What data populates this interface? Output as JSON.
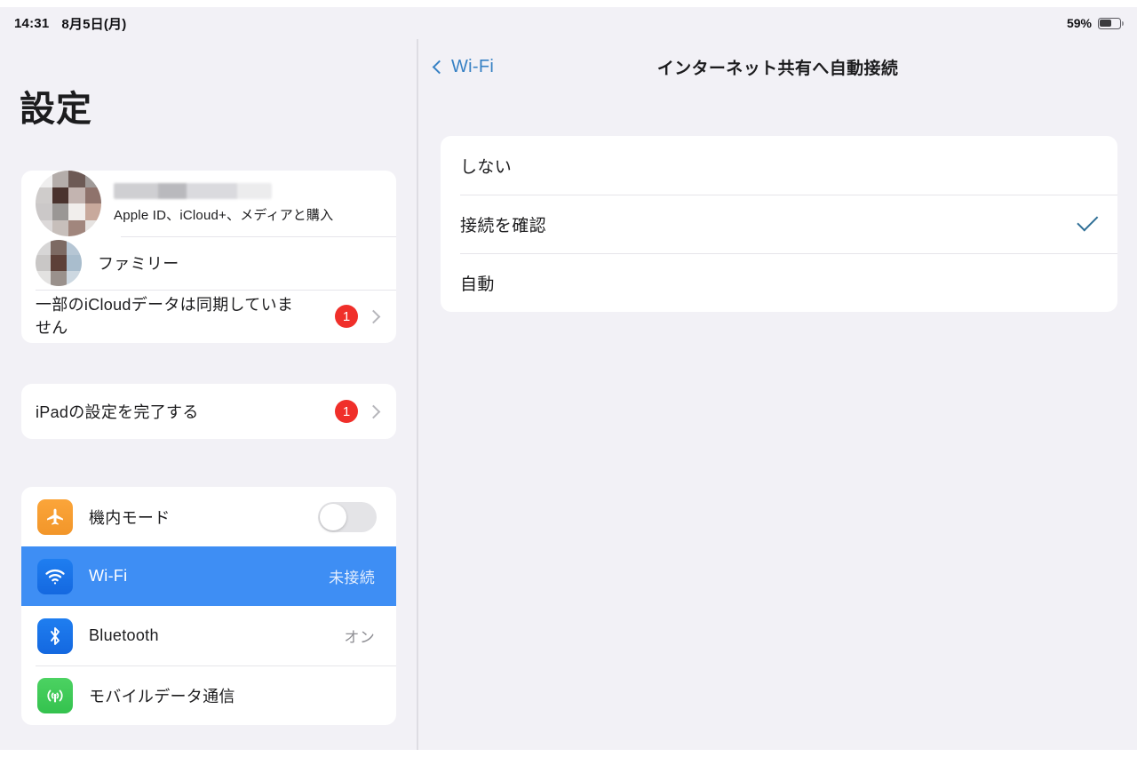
{
  "status_bar": {
    "time": "14:31",
    "date": "8月5日(月)",
    "battery_percent": "59%",
    "battery_level": 59
  },
  "sidebar": {
    "title": "設定",
    "account_card": {
      "name_redacted": true,
      "subtitle": "Apple ID、iCloud+、メディアと購入",
      "family_label": "ファミリー",
      "icloud_warning": "一部のiCloudデータは同期していません",
      "icloud_badge": "1"
    },
    "setup_card": {
      "label": "iPadの設定を完了する",
      "badge": "1"
    },
    "connectivity": [
      {
        "label": "機内モード",
        "icon": "airplane-icon",
        "control": "toggle",
        "toggle_on": false,
        "value": ""
      },
      {
        "label": "Wi-Fi",
        "icon": "wifi-icon",
        "control": "value",
        "value": "未接続",
        "selected": true
      },
      {
        "label": "Bluetooth",
        "icon": "bluetooth-icon",
        "control": "value",
        "value": "オン",
        "selected": false
      },
      {
        "label": "モバイルデータ通信",
        "icon": "cellular-icon",
        "control": "value",
        "value": "",
        "selected": false
      }
    ]
  },
  "detail": {
    "back_label": "Wi-Fi",
    "title": "インターネット共有へ自動接続",
    "options": [
      {
        "label": "しない",
        "checked": false
      },
      {
        "label": "接続を確認",
        "checked": true
      },
      {
        "label": "自動",
        "checked": false
      }
    ]
  },
  "colors": {
    "accent_blue": "#3e8ef4",
    "link_blue": "#3781c4",
    "badge_red": "#f02f2a",
    "background": "#f2f1f6",
    "card": "#ffffff",
    "check_blue": "#2f6f96"
  }
}
